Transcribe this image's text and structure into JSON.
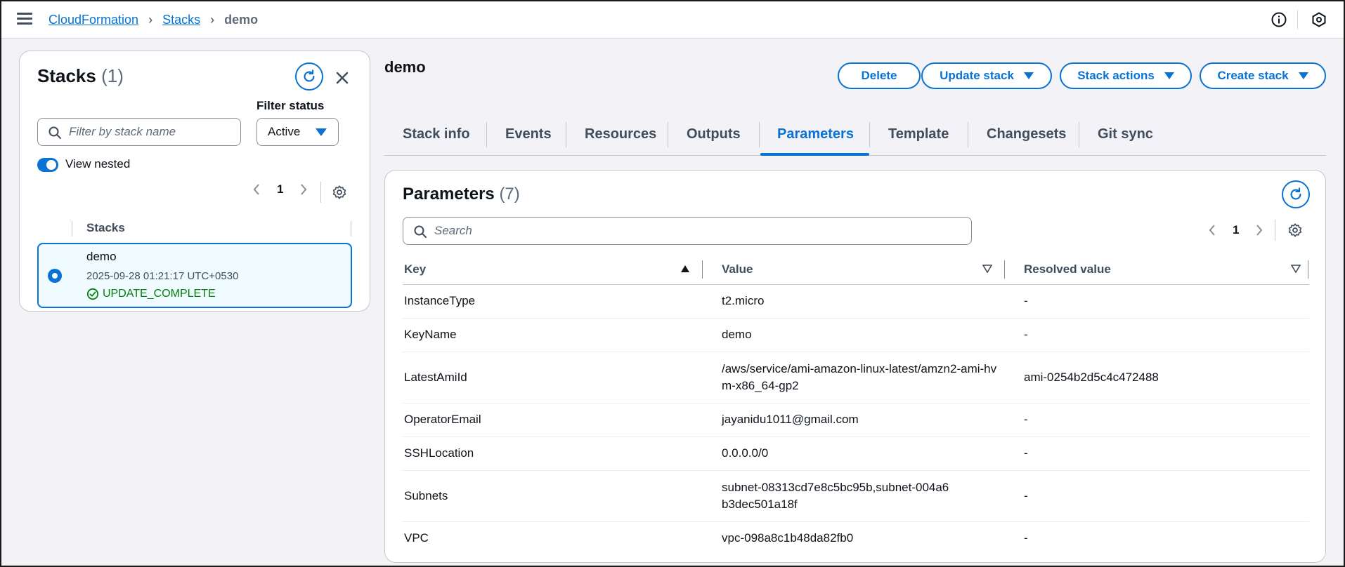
{
  "breadcrumb": {
    "service": "CloudFormation",
    "section": "Stacks",
    "current": "demo"
  },
  "left_panel": {
    "title": "Stacks",
    "count": "(1)",
    "filter_status_label": "Filter status",
    "filter_placeholder": "Filter by stack name",
    "filter_status_value": "Active",
    "view_nested_label": "View nested",
    "view_nested_on": true,
    "page": "1",
    "column_header": "Stacks",
    "stacks": [
      {
        "name": "demo",
        "date": "2025-09-28 01:21:17 UTC+0530",
        "status": "UPDATE_COMPLETE",
        "selected": true
      }
    ]
  },
  "main": {
    "title": "demo",
    "actions": {
      "delete": "Delete",
      "update": "Update stack",
      "stack_actions": "Stack actions",
      "create": "Create stack"
    },
    "tabs": [
      "Stack info",
      "Events",
      "Resources",
      "Outputs",
      "Parameters",
      "Template",
      "Changesets",
      "Git sync"
    ],
    "active_tab": "Parameters",
    "parameters": {
      "title": "Parameters",
      "count": "(7)",
      "search_placeholder": "Search",
      "page": "1",
      "columns": [
        "Key",
        "Value",
        "Resolved value"
      ],
      "rows": [
        {
          "key": "InstanceType",
          "value": "t2.micro",
          "resolved": "-"
        },
        {
          "key": "KeyName",
          "value": "demo",
          "resolved": "-"
        },
        {
          "key": "LatestAmiId",
          "value": "/aws/service/ami-amazon-linux-latest/amzn2-ami-hvm-x86_64-gp2",
          "resolved": "ami-0254b2d5c4c472488"
        },
        {
          "key": "OperatorEmail",
          "value": "jayanidu1011@gmail.com",
          "resolved": "-"
        },
        {
          "key": "SSHLocation",
          "value": "0.0.0.0/0",
          "resolved": "-"
        },
        {
          "key": "Subnets",
          "value": "subnet-08313cd7e8c5bc95b,subnet-004a6b3dec501a18f",
          "resolved": "-"
        },
        {
          "key": "VPC",
          "value": "vpc-098a8c1b48da82fb0",
          "resolved": "-"
        }
      ]
    }
  },
  "colors": {
    "accent": "#0972d3",
    "success": "#037f0c",
    "selected_bg": "#f0fbff"
  }
}
